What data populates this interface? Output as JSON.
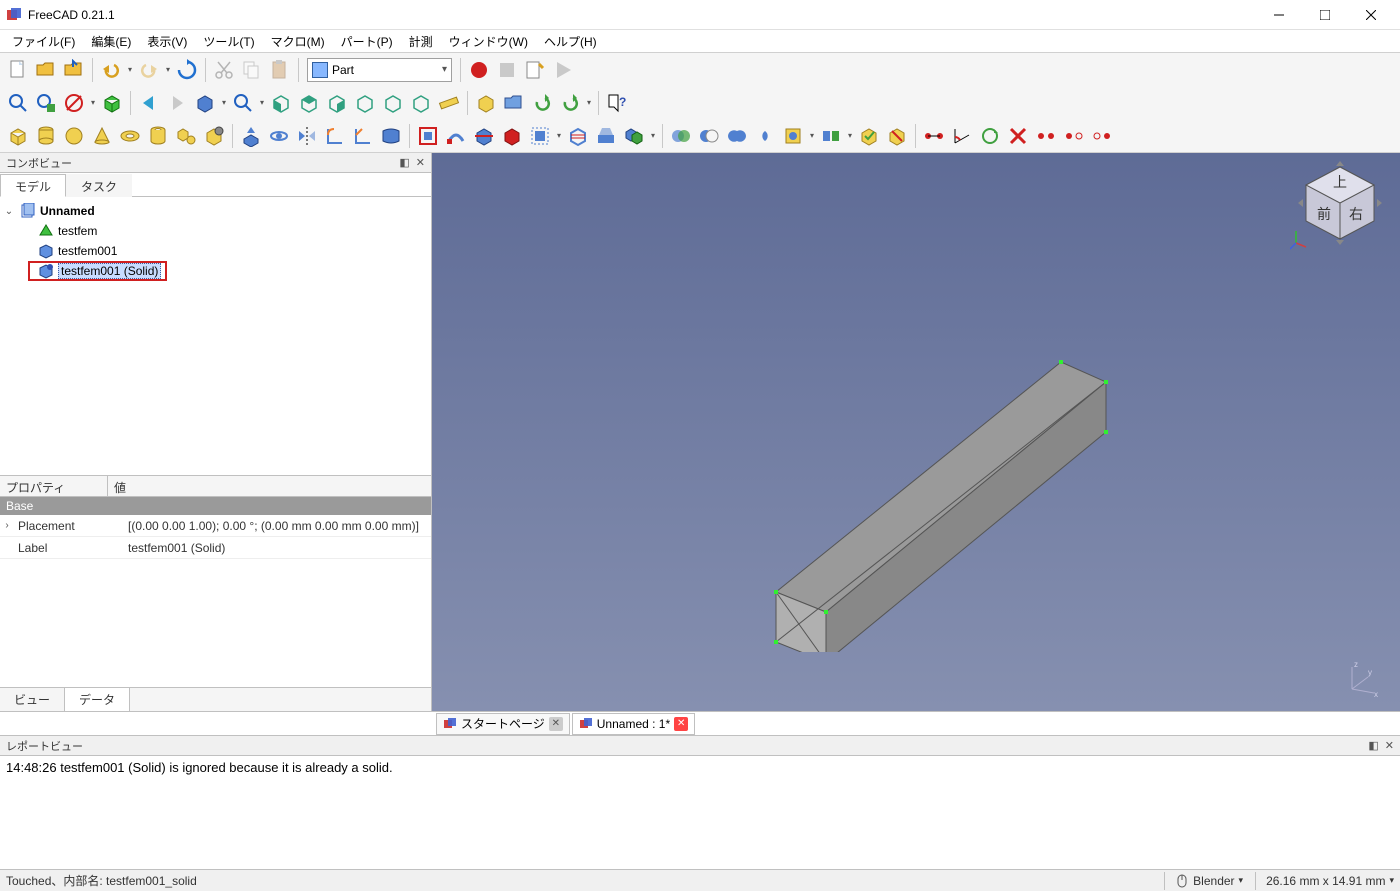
{
  "app": {
    "title": "FreeCAD 0.21.1"
  },
  "menu": {
    "file": "ファイル(F)",
    "edit": "編集(E)",
    "view": "表示(V)",
    "tools": "ツール(T)",
    "macro": "マクロ(M)",
    "part": "パート(P)",
    "measure": "計測",
    "window": "ウィンドウ(W)",
    "help": "ヘルプ(H)"
  },
  "workbench": {
    "selected": "Part"
  },
  "panels": {
    "combo_title": "コンボビュー",
    "tab_model": "モデル",
    "tab_task": "タスク",
    "prop_col_prop": "プロパティ",
    "prop_col_val": "値",
    "prop_group": "Base",
    "prop_rows": [
      {
        "key": "Placement",
        "value": "[(0.00 0.00 1.00); 0.00 °; (0.00 mm  0.00 mm  0.00 mm)]",
        "expandable": true
      },
      {
        "key": "Label",
        "value": "testfem001 (Solid)",
        "expandable": false
      }
    ],
    "view_tab": "ビュー",
    "data_tab": "データ",
    "report_title": "レポートビュー"
  },
  "tree": {
    "root": "Unnamed",
    "children": [
      {
        "label": "testfem",
        "icon": "mesh"
      },
      {
        "label": "testfem001",
        "icon": "box"
      },
      {
        "label": "testfem001 (Solid)",
        "icon": "solid",
        "selected": true,
        "highlighted": true
      }
    ]
  },
  "doc_tabs": {
    "start": "スタートページ",
    "doc": "Unnamed : 1*"
  },
  "report": {
    "line": "14:48:26  testfem001 (Solid) is ignored because it is already a solid."
  },
  "status": {
    "left": "Touched、内部名: testfem001_solid",
    "nav_style": "Blender",
    "dims": "26.16 mm x 14.91 mm"
  },
  "navcube": {
    "top": "上",
    "front": "前",
    "right": "右"
  }
}
